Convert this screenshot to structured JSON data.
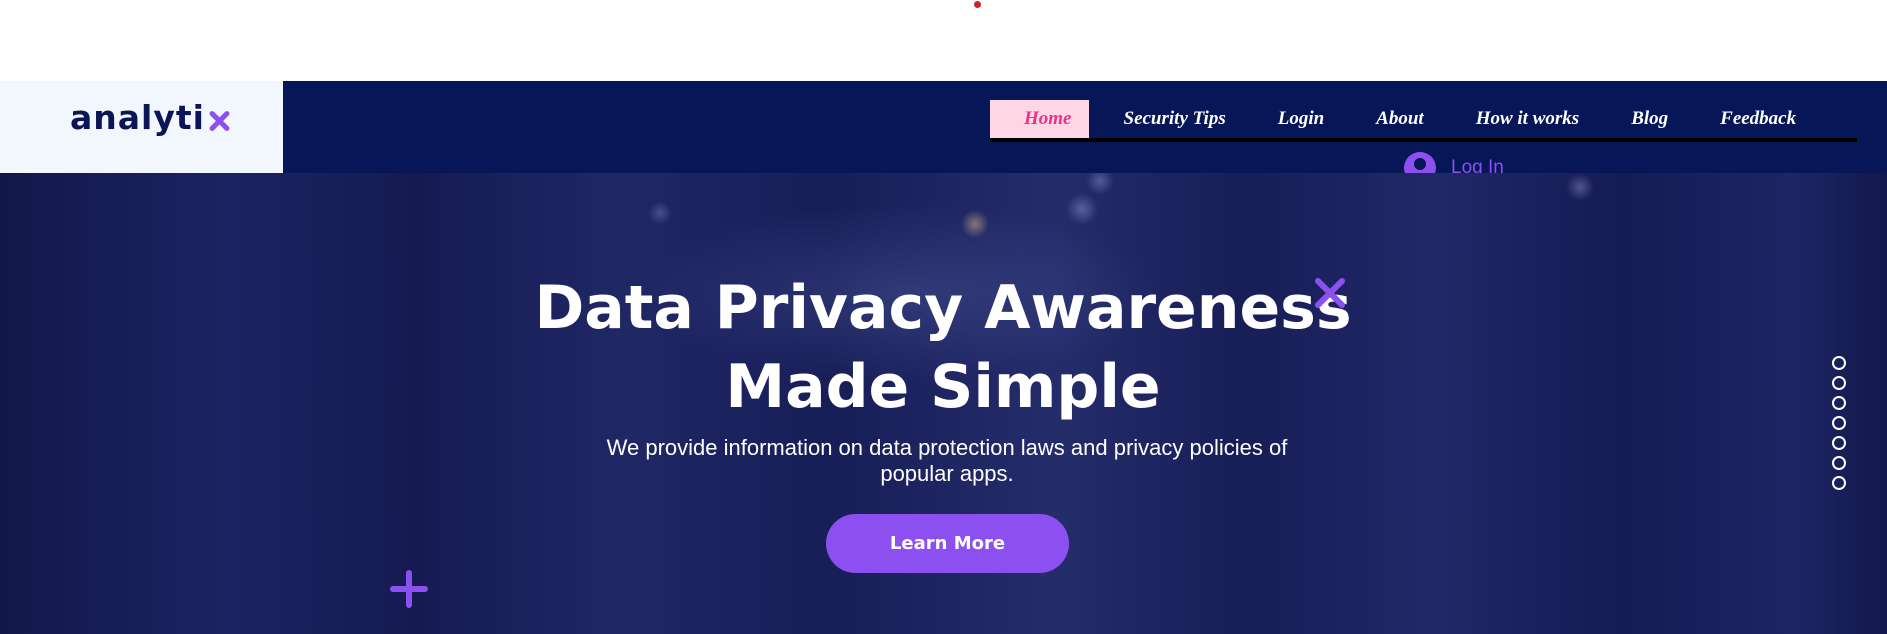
{
  "brand": {
    "name": "analyti",
    "accent_color": "#8c50f0",
    "header_bg": "#061656"
  },
  "nav": {
    "items": [
      {
        "label": "Home",
        "active": true
      },
      {
        "label": "Security Tips"
      },
      {
        "label": "Login"
      },
      {
        "label": "About"
      },
      {
        "label": "How it works"
      },
      {
        "label": "Blog"
      },
      {
        "label": "Feedback"
      }
    ],
    "login_label": "Log In",
    "login_icon": "user-avatar-icon"
  },
  "hero": {
    "title_line1": "Data Privacy Awareness",
    "title_line2": "Made Simple",
    "subtitle": "We provide information on data protection laws and privacy policies of popular apps.",
    "cta_label": "Learn More"
  },
  "slider": {
    "dot_count": 7
  }
}
